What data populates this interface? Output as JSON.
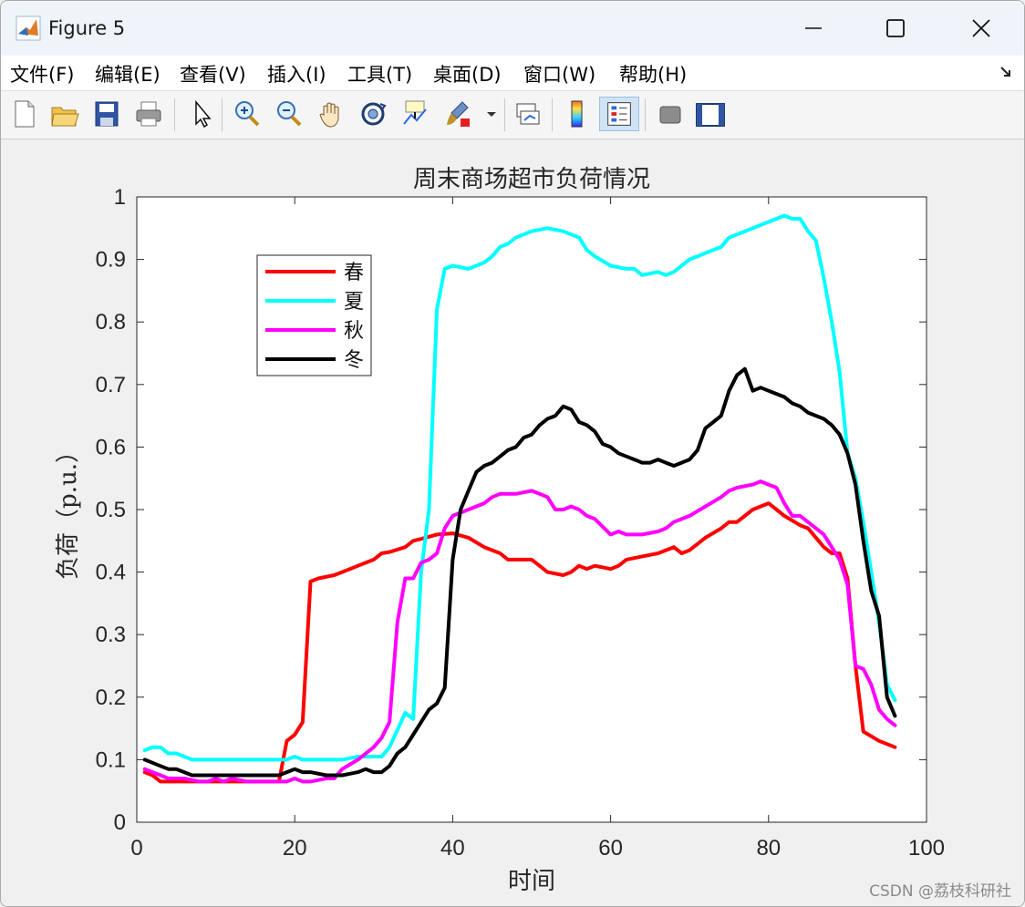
{
  "window": {
    "title": "Figure 5"
  },
  "menu": [
    {
      "label": "文件(F)"
    },
    {
      "label": "编辑(E)"
    },
    {
      "label": "查看(V)"
    },
    {
      "label": "插入(I)"
    },
    {
      "label": "工具(T)"
    },
    {
      "label": "桌面(D)"
    },
    {
      "label": "窗口(W)"
    },
    {
      "label": "帮助(H)"
    }
  ],
  "toolbar": {
    "icons": [
      "new-figure-icon",
      "open-file-icon",
      "save-icon",
      "print-icon",
      "pointer-icon",
      "zoom-in-icon",
      "zoom-out-icon",
      "pan-hand-icon",
      "rotate-3d-icon",
      "data-cursor-icon",
      "brush-icon",
      "link-plot-icon",
      "colorbar-icon",
      "legend-icon",
      "hide-plot-tools-icon",
      "show-plot-tools-icon"
    ]
  },
  "watermark": "CSDN @荔枝科研社",
  "chart_data": {
    "type": "line",
    "title": "周末商场超市负荷情况",
    "xlabel": "时间",
    "ylabel": "负荷（p.u.）",
    "xlim": [
      0,
      100
    ],
    "ylim": [
      0,
      1
    ],
    "xticks": [
      0,
      20,
      40,
      60,
      80,
      100
    ],
    "yticks": [
      0,
      0.1,
      0.2,
      0.3,
      0.4,
      0.5,
      0.6,
      0.7,
      0.8,
      0.9,
      1
    ],
    "ytick_labels": [
      "0",
      "0.1",
      "0.2",
      "0.3",
      "0.4",
      "0.5",
      "0.6",
      "0.7",
      "0.8",
      "0.9",
      "1"
    ],
    "grid": false,
    "legend_position": "top-left",
    "series": [
      {
        "name": "春",
        "color": "#ff0000",
        "x": [
          1,
          2,
          3,
          4,
          6,
          8,
          10,
          12,
          14,
          16,
          17,
          18,
          19,
          20,
          21,
          22,
          23,
          25,
          26,
          28,
          30,
          31,
          32,
          34,
          35,
          36,
          38,
          40,
          42,
          44,
          45,
          46,
          47,
          48,
          50,
          51,
          52,
          54,
          55,
          56,
          57,
          58,
          60,
          61,
          62,
          64,
          66,
          67,
          68,
          69,
          70,
          72,
          74,
          75,
          76,
          78,
          80,
          81,
          82,
          84,
          85,
          86,
          87,
          88,
          89,
          90,
          91,
          92,
          94,
          96
        ],
        "y": [
          0.08,
          0.075,
          0.065,
          0.065,
          0.065,
          0.065,
          0.065,
          0.065,
          0.065,
          0.065,
          0.065,
          0.065,
          0.13,
          0.14,
          0.16,
          0.385,
          0.39,
          0.395,
          0.4,
          0.41,
          0.42,
          0.43,
          0.432,
          0.44,
          0.45,
          0.453,
          0.46,
          0.462,
          0.455,
          0.44,
          0.435,
          0.43,
          0.42,
          0.42,
          0.42,
          0.41,
          0.4,
          0.395,
          0.4,
          0.41,
          0.405,
          0.41,
          0.405,
          0.41,
          0.42,
          0.425,
          0.43,
          0.435,
          0.44,
          0.43,
          0.435,
          0.455,
          0.47,
          0.48,
          0.48,
          0.5,
          0.51,
          0.5,
          0.49,
          0.475,
          0.47,
          0.455,
          0.44,
          0.43,
          0.43,
          0.39,
          0.25,
          0.145,
          0.13,
          0.12
        ]
      },
      {
        "name": "夏",
        "color": "#00ffff",
        "x": [
          1,
          2,
          3,
          4,
          5,
          6,
          7,
          8,
          10,
          12,
          14,
          16,
          18,
          19,
          20,
          21,
          22,
          24,
          26,
          28,
          30,
          31,
          32,
          34,
          35,
          36,
          37,
          38,
          39,
          40,
          42,
          44,
          45,
          46,
          47,
          48,
          50,
          52,
          54,
          55,
          56,
          57,
          58,
          60,
          62,
          63,
          64,
          66,
          67,
          68,
          70,
          71,
          72,
          74,
          75,
          76,
          78,
          80,
          81,
          82,
          83,
          84,
          85,
          86,
          87,
          88,
          89,
          90,
          91,
          92,
          93,
          94,
          95,
          96
        ],
        "y": [
          0.115,
          0.12,
          0.12,
          0.11,
          0.11,
          0.105,
          0.1,
          0.1,
          0.1,
          0.1,
          0.1,
          0.1,
          0.1,
          0.1,
          0.105,
          0.1,
          0.1,
          0.1,
          0.1,
          0.105,
          0.105,
          0.105,
          0.12,
          0.175,
          0.165,
          0.4,
          0.5,
          0.82,
          0.885,
          0.89,
          0.885,
          0.895,
          0.905,
          0.92,
          0.925,
          0.935,
          0.945,
          0.95,
          0.945,
          0.94,
          0.935,
          0.915,
          0.905,
          0.89,
          0.885,
          0.885,
          0.875,
          0.88,
          0.875,
          0.88,
          0.9,
          0.905,
          0.91,
          0.92,
          0.935,
          0.94,
          0.95,
          0.96,
          0.965,
          0.97,
          0.965,
          0.965,
          0.945,
          0.93,
          0.87,
          0.8,
          0.72,
          0.59,
          0.55,
          0.48,
          0.4,
          0.32,
          0.22,
          0.195
        ]
      },
      {
        "name": "秋",
        "color": "#ff00ff",
        "x": [
          1,
          2,
          3,
          4,
          6,
          8,
          9,
          10,
          11,
          12,
          14,
          16,
          18,
          19,
          20,
          21,
          22,
          24,
          25,
          26,
          28,
          30,
          31,
          32,
          33,
          34,
          35,
          36,
          37,
          38,
          39,
          40,
          41,
          42,
          44,
          45,
          46,
          48,
          50,
          51,
          52,
          53,
          54,
          55,
          56,
          57,
          58,
          60,
          61,
          62,
          64,
          66,
          67,
          68,
          70,
          72,
          74,
          75,
          76,
          78,
          79,
          80,
          81,
          82,
          83,
          84,
          85,
          86,
          87,
          88,
          89,
          90,
          91,
          92,
          93,
          94,
          95,
          96
        ],
        "y": [
          0.085,
          0.08,
          0.075,
          0.07,
          0.07,
          0.065,
          0.065,
          0.07,
          0.065,
          0.07,
          0.065,
          0.065,
          0.065,
          0.065,
          0.07,
          0.065,
          0.065,
          0.07,
          0.07,
          0.085,
          0.1,
          0.12,
          0.135,
          0.16,
          0.32,
          0.39,
          0.39,
          0.415,
          0.42,
          0.43,
          0.47,
          0.49,
          0.495,
          0.5,
          0.51,
          0.52,
          0.525,
          0.525,
          0.53,
          0.525,
          0.52,
          0.5,
          0.5,
          0.505,
          0.5,
          0.49,
          0.485,
          0.46,
          0.465,
          0.46,
          0.46,
          0.465,
          0.47,
          0.48,
          0.49,
          0.505,
          0.52,
          0.53,
          0.535,
          0.54,
          0.545,
          0.54,
          0.535,
          0.51,
          0.49,
          0.49,
          0.48,
          0.47,
          0.46,
          0.44,
          0.42,
          0.38,
          0.25,
          0.245,
          0.22,
          0.18,
          0.165,
          0.155
        ]
      },
      {
        "name": "冬",
        "color": "#000000",
        "x": [
          1,
          2,
          3,
          4,
          5,
          6,
          7,
          8,
          10,
          12,
          14,
          16,
          18,
          19,
          20,
          21,
          22,
          24,
          26,
          28,
          29,
          30,
          31,
          32,
          33,
          34,
          35,
          36,
          37,
          38,
          39,
          40,
          41,
          42,
          43,
          44,
          45,
          46,
          47,
          48,
          49,
          50,
          51,
          52,
          53,
          54,
          55,
          56,
          57,
          58,
          59,
          60,
          61,
          62,
          63,
          64,
          65,
          66,
          67,
          68,
          69,
          70,
          71,
          72,
          73,
          74,
          75,
          76,
          77,
          78,
          79,
          80,
          81,
          82,
          83,
          84,
          85,
          86,
          87,
          88,
          89,
          90,
          91,
          92,
          93,
          94,
          95,
          96
        ],
        "y": [
          0.1,
          0.095,
          0.09,
          0.085,
          0.085,
          0.08,
          0.075,
          0.075,
          0.075,
          0.075,
          0.075,
          0.075,
          0.075,
          0.08,
          0.085,
          0.08,
          0.08,
          0.075,
          0.075,
          0.08,
          0.085,
          0.08,
          0.08,
          0.09,
          0.11,
          0.12,
          0.14,
          0.16,
          0.18,
          0.19,
          0.215,
          0.42,
          0.5,
          0.53,
          0.56,
          0.57,
          0.575,
          0.585,
          0.595,
          0.6,
          0.615,
          0.62,
          0.635,
          0.645,
          0.65,
          0.665,
          0.66,
          0.64,
          0.635,
          0.625,
          0.605,
          0.6,
          0.59,
          0.585,
          0.58,
          0.575,
          0.575,
          0.58,
          0.575,
          0.57,
          0.575,
          0.58,
          0.595,
          0.63,
          0.64,
          0.65,
          0.69,
          0.715,
          0.725,
          0.69,
          0.695,
          0.69,
          0.685,
          0.68,
          0.67,
          0.665,
          0.655,
          0.65,
          0.645,
          0.635,
          0.62,
          0.59,
          0.54,
          0.45,
          0.37,
          0.33,
          0.2,
          0.17
        ]
      }
    ]
  }
}
